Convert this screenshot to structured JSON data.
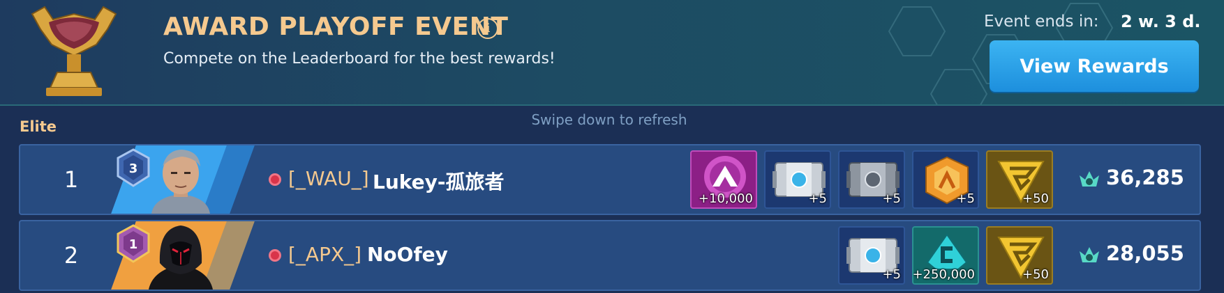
{
  "header": {
    "title": "AWARD PLAYOFF EVENT",
    "subtitle": "Compete on the Leaderboard for the best rewards!",
    "ends_label": "Event ends in:",
    "ends_value": "2 w. 3 d.",
    "view_rewards_label": "View Rewards",
    "info_glyph": "i"
  },
  "leaderboard": {
    "tier": "Elite",
    "refresh_hint": "Swipe down to refresh",
    "rows": [
      {
        "rank": "1",
        "alliance": "[_WAU_]",
        "name": "Lukey-孤旅者",
        "medal_level": "3",
        "rewards": [
          {
            "type": "premium-currency-icon",
            "qty": "+10,000"
          },
          {
            "type": "silver-cube-crystal-icon",
            "qty": "+5"
          },
          {
            "type": "dark-cube-crystal-icon",
            "qty": "+5"
          },
          {
            "type": "gold-cube-crystal-icon",
            "qty": "+5"
          },
          {
            "type": "gold-token-icon",
            "qty": "+50"
          }
        ],
        "score": "36,285"
      },
      {
        "rank": "2",
        "alliance": "[_APX_]",
        "name": "NoOfey",
        "medal_level": "1",
        "rewards": [
          {
            "type": "silver-cube-crystal-icon",
            "qty": "+5"
          },
          {
            "type": "credits-icon",
            "qty": "+250,000"
          },
          {
            "type": "gold-token-icon",
            "qty": "+50"
          }
        ],
        "score": "28,055"
      }
    ]
  },
  "colors": {
    "accent_gold": "#f5c98f",
    "button_blue": "#1d8fdd",
    "row_bg": "#274b80",
    "premium_purple": "#8c1f86",
    "online_red": "#d9344a"
  }
}
